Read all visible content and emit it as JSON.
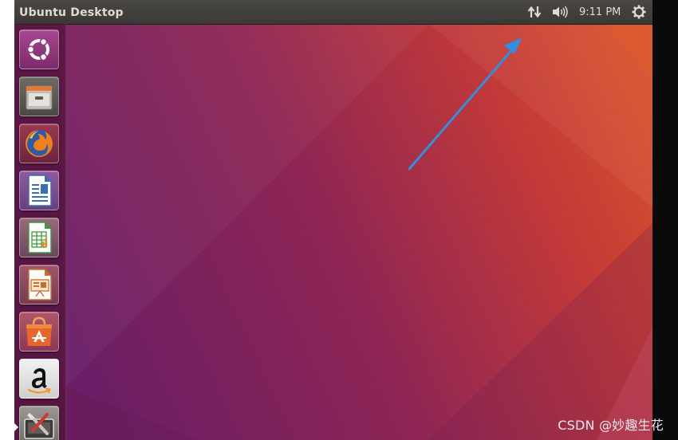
{
  "panel": {
    "window_title": "Ubuntu Desktop",
    "clock": "9:11 PM"
  },
  "icons": {
    "network": "network-updown-icon",
    "volume": "speaker-volume-icon",
    "session": "gear-power-icon"
  },
  "launcher": {
    "items": [
      {
        "name": "dash-home",
        "icon": "ubuntu-logo-icon"
      },
      {
        "name": "files",
        "icon": "file-cabinet-icon"
      },
      {
        "name": "firefox",
        "icon": "firefox-icon"
      },
      {
        "name": "libreoffice-writer",
        "icon": "writer-document-icon"
      },
      {
        "name": "libreoffice-calc",
        "icon": "calc-spreadsheet-icon"
      },
      {
        "name": "libreoffice-impress",
        "icon": "impress-presentation-icon"
      },
      {
        "name": "ubuntu-software",
        "icon": "shopping-bag-a-icon"
      },
      {
        "name": "amazon",
        "icon": "amazon-a-icon"
      },
      {
        "name": "system-settings",
        "icon": "settings-tools-icon"
      }
    ]
  },
  "annotation": {
    "arrow": "blue-arrow-pointing-to-panel"
  },
  "watermark": "CSDN @妙趣生花",
  "colors": {
    "panel": "#3c3b37",
    "wallpaper_left": "#6e1f63",
    "wallpaper_right": "#d5482a",
    "arrow": "#2f8fe0"
  }
}
